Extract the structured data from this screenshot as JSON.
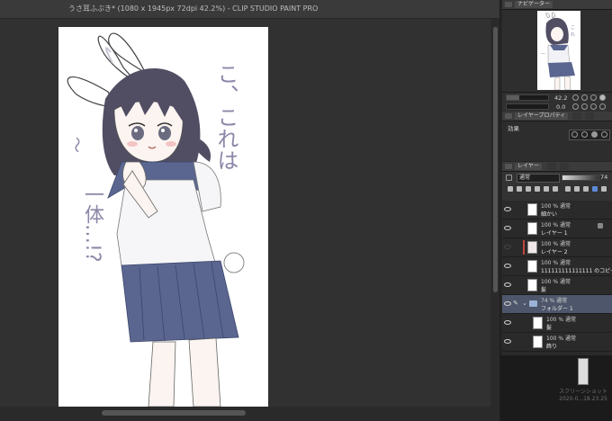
{
  "window": {
    "title": "うさ耳ふぶき* (1080 x 1945px 72dpi 42.2%)  - CLIP STUDIO PAINT PRO"
  },
  "artwork": {
    "handwritten_lines": [
      "こ、これは",
      "一体…!?"
    ],
    "side_mark": "〜"
  },
  "navigator": {
    "tab_label": "ナビゲーター",
    "zoom": "42.2",
    "rotation": "0.0"
  },
  "layer_property": {
    "tab_label": "レイヤープロパティ",
    "effect_label": "効果"
  },
  "layer_panel": {
    "tab_label": "レイヤー",
    "blend_mode": "通常",
    "opacity": "74",
    "layers": [
      {
        "top": "100 % 通常",
        "name": "細かい",
        "visible": true
      },
      {
        "top": "100 % 通常",
        "name": "レイヤー 1",
        "visible": true
      },
      {
        "top": "100 % 通常",
        "name": "レイヤー 2",
        "visible": false
      },
      {
        "top": "100 % 通常",
        "name": "111111111111111 のコピー",
        "visible": true
      },
      {
        "top": "100 % 通常",
        "name": "髪",
        "visible": true
      },
      {
        "top": "74 % 通常",
        "name": "フォルダー 1",
        "visible": true,
        "selected": true,
        "folder": true
      },
      {
        "top": "100 % 通常",
        "name": "髪",
        "visible": true
      },
      {
        "top": "100 % 通常",
        "name": "飾り",
        "visible": true
      }
    ]
  },
  "desktop": {
    "screenshot_label": "スクリーンショット 2020-0...18.23.25"
  },
  "colors": {
    "panel_bg": "#262626",
    "selected_layer": "#4d566a",
    "skirt": "#5a6690",
    "hair": "#514d63"
  }
}
